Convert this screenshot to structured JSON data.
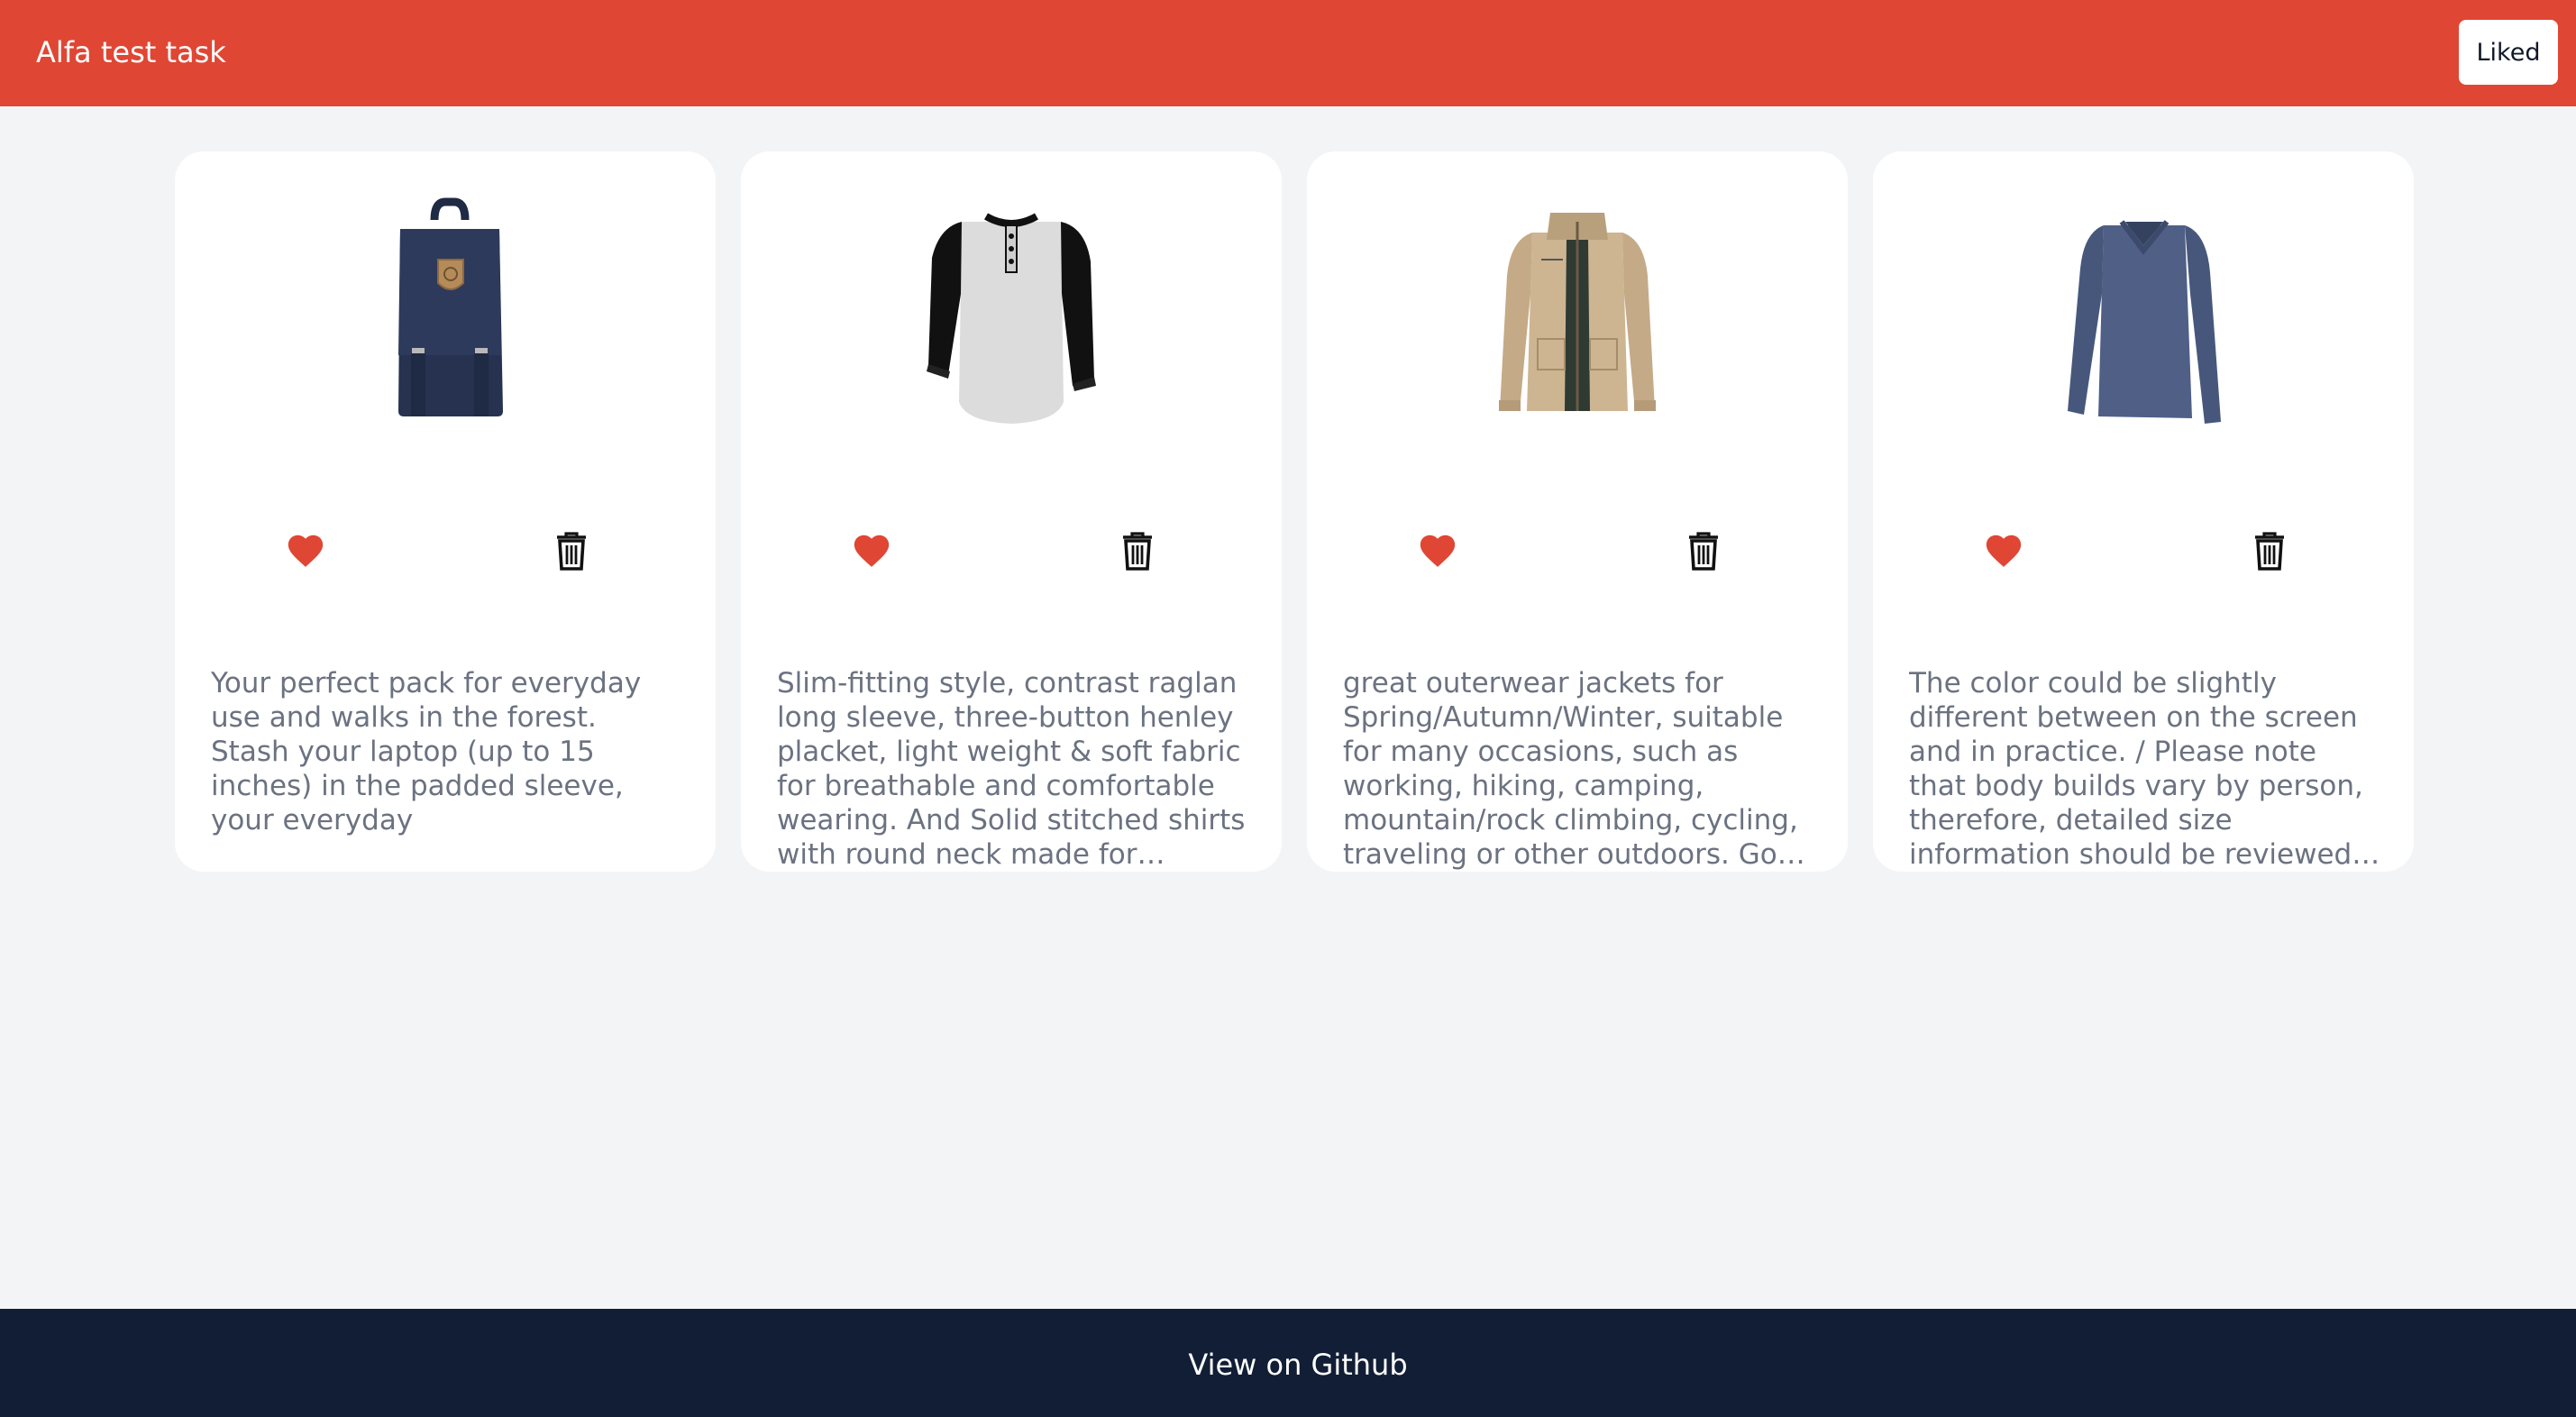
{
  "header": {
    "title": "Alfa test task",
    "liked_label": "Liked",
    "background": "#e04634"
  },
  "products": [
    {
      "image": "navy-backpack",
      "liked": true,
      "description": "Your perfect pack for everyday use and walks in the forest. Stash your laptop (up to 15 inches) in the padded sleeve, your everyday"
    },
    {
      "image": "raglan-henley-shirt",
      "liked": true,
      "description": "Slim-fitting style, contrast raglan long sleeve, three-button henley placket, light weight & soft fabric for breathable and comfortable wearing. And Solid stitched shirts with round neck made for durability and a great fit for casual fashion wear and diehard baseball fans. The Henley style round neckline includes a three-button placket."
    },
    {
      "image": "khaki-jacket",
      "liked": true,
      "description": "great outerwear jackets for Spring/Autumn/Winter, suitable for many occasions, such as working, hiking, camping, mountain/rock climbing, cycling, traveling or other outdoors. Good gift choice for you or your family member. A warm hearted love to Father, husband or son in this thanksgiving or Christmas Day."
    },
    {
      "image": "blue-long-sleeve-tee",
      "liked": true,
      "description": "The color could be slightly different between on the screen and in practice. / Please note that body builds vary by person, therefore, detailed size information should be reviewed below on the product description."
    }
  ],
  "colors": {
    "heart": "#e04634",
    "trash": "#111111",
    "page_background": "#f3f4f6",
    "footer_background": "#111e35"
  },
  "footer": {
    "link_label": "View on Github"
  }
}
